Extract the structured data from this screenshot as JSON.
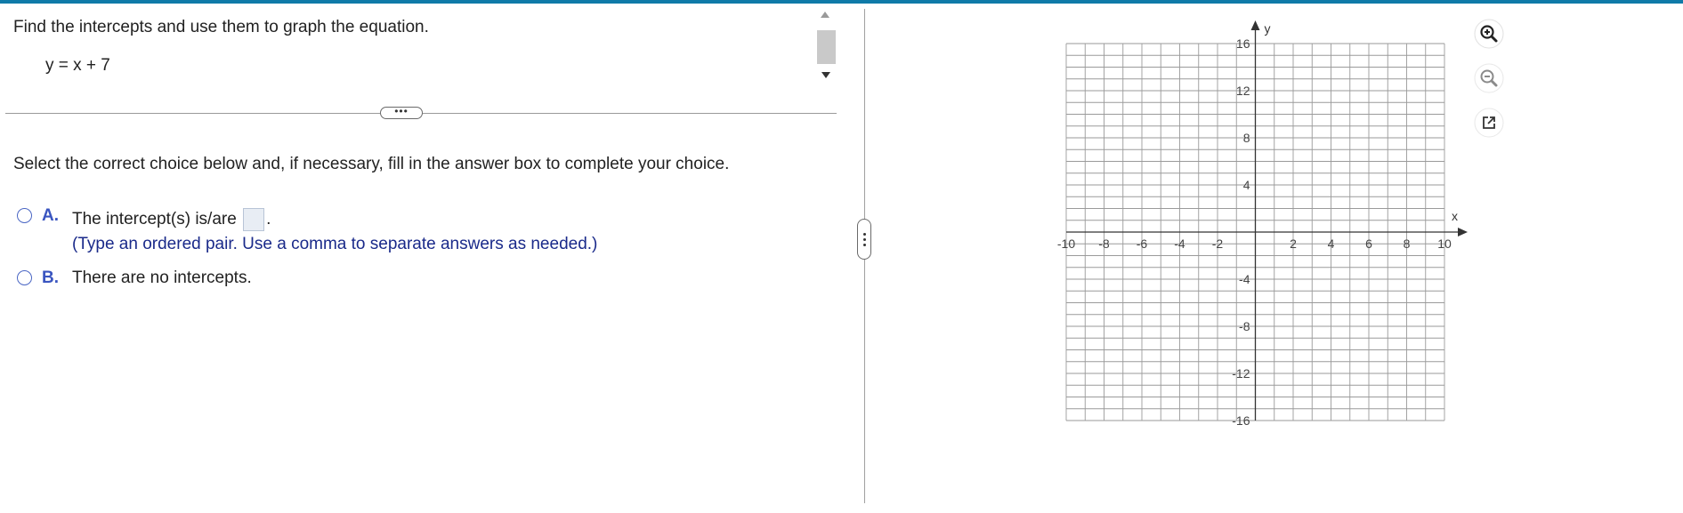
{
  "question": {
    "prompt": "Find the intercepts and use them to graph the equation.",
    "equation": "y = x + 7",
    "expand_label": "•••"
  },
  "answer_section": {
    "instruction": "Select the correct choice below and, if necessary, fill in the answer box to complete your choice.",
    "choices": [
      {
        "letter": "A.",
        "text_before": "The intercept(s) is/are",
        "text_after": ".",
        "hint": "(Type an ordered pair.  Use a comma to separate answers as needed.)"
      },
      {
        "letter": "B.",
        "text": "There are no intercepts."
      }
    ]
  },
  "graph": {
    "x_axis_label": "x",
    "y_axis_label": "y",
    "x_ticks": [
      "-10",
      "-8",
      "-6",
      "-4",
      "-2",
      "2",
      "4",
      "6",
      "8",
      "10"
    ],
    "y_ticks": [
      "16",
      "12",
      "8",
      "4",
      "-4",
      "-8",
      "-12",
      "-16"
    ],
    "x_range": [
      -10,
      10
    ],
    "y_range": [
      -16,
      16
    ],
    "grid_color": "#9a9a9a",
    "axis_color": "#333333"
  },
  "tools": {
    "zoom_in": "zoom-in-icon",
    "zoom_out": "zoom-out-icon",
    "popout": "popout-icon"
  },
  "colors": {
    "accent": "#0f7aa8",
    "choice_letter": "#3a55c0",
    "hint_text": "#1a2a8a"
  }
}
